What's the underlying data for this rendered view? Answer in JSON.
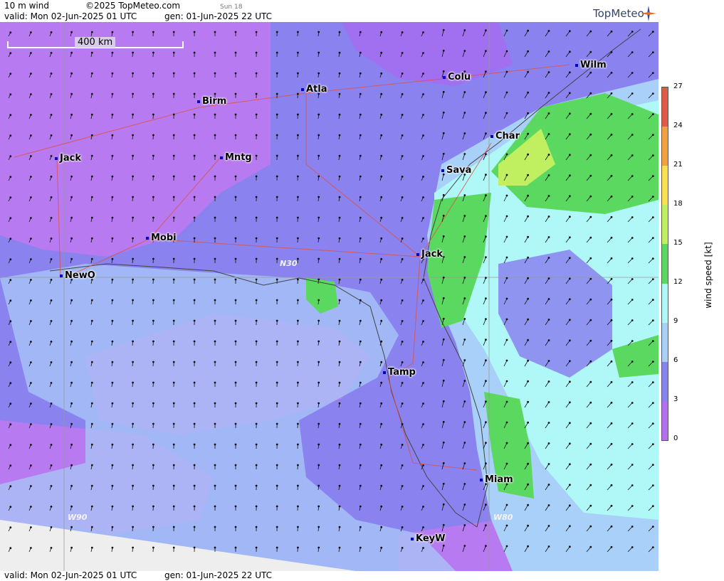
{
  "header": {
    "product": "10 m wind",
    "copyright": "©2025 TopMeteo.com",
    "sun_note": "Sun 18",
    "valid": "valid:  Mon  02-Jun-2025  01 UTC",
    "generated": "gen:  01-Jun-2025 22 UTC",
    "logo": "TopMeteo"
  },
  "footer": {
    "valid": "valid:  Mon  02-Jun-2025  01 UTC",
    "generated": "gen:  01-Jun-2025 22 UTC"
  },
  "map": {
    "scale_label": "400 km",
    "cities": [
      "Birm",
      "Atla",
      "Colu",
      "Wilm",
      "Char",
      "Jack",
      "Mntg",
      "Sava",
      "Mobi",
      "Jack",
      "NewO",
      "Tamp",
      "Miam",
      "KeyW"
    ],
    "grid_labels": [
      "N30",
      "W90",
      "W80"
    ]
  },
  "legend": {
    "title": "wind speed [kt]",
    "ticks": [
      "27",
      "24",
      "21",
      "18",
      "15",
      "12",
      "9",
      "6",
      "3",
      "0"
    ],
    "colors": [
      "#e05a48",
      "#f0a040",
      "#f8e050",
      "#c0f060",
      "#5ad860",
      "#b0f8f8",
      "#a8d0f8",
      "#8484f0",
      "#b070f0"
    ]
  }
}
